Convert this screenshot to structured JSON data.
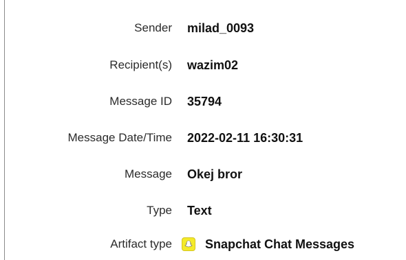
{
  "fields": [
    {
      "label": "Sender",
      "value": "milad_0093"
    },
    {
      "label": "Recipient(s)",
      "value": "wazim02"
    },
    {
      "label": "Message ID",
      "value": "35794"
    },
    {
      "label": "Message Date/Time",
      "value": "2022-02-11 16:30:31"
    },
    {
      "label": "Message",
      "value": "Okej bror"
    },
    {
      "label": "Type",
      "value": "Text"
    }
  ],
  "artifact": {
    "label": "Artifact type",
    "value": "Snapchat Chat Messages",
    "icon": "snapchat-icon",
    "icon_color": "#F4EA2A"
  }
}
